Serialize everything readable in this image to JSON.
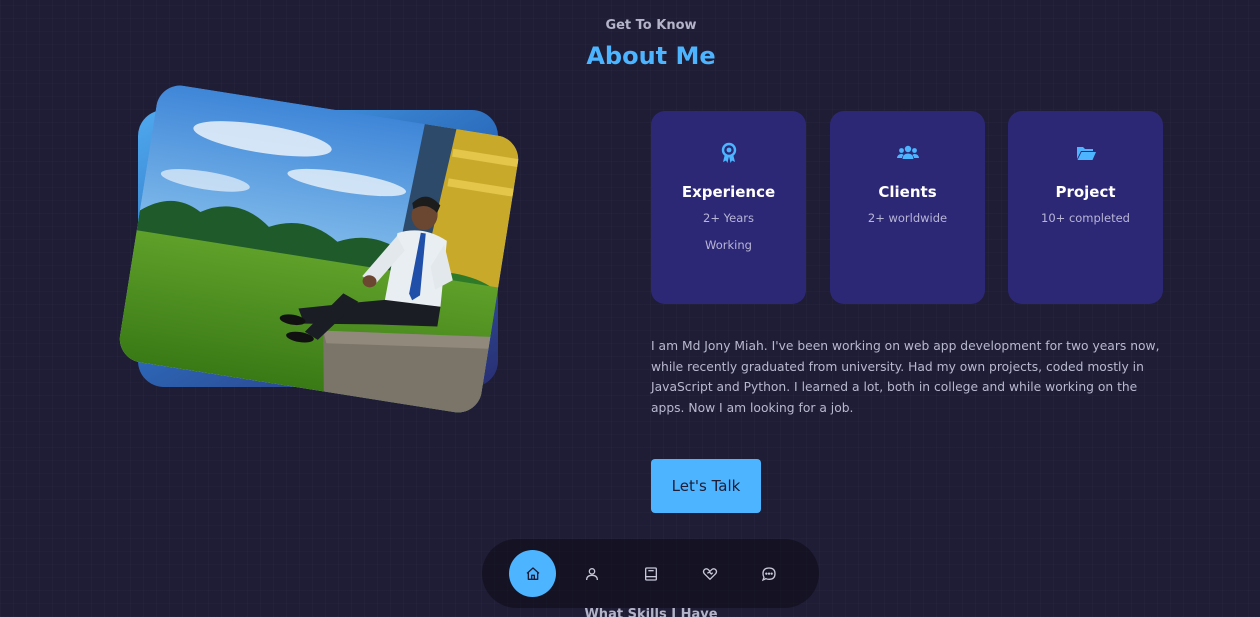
{
  "section": {
    "kicker": "Get To Know",
    "title": "About Me"
  },
  "cards": [
    {
      "icon": "award-icon",
      "title": "Experience",
      "subtitle": "2+ Years Working"
    },
    {
      "icon": "users-icon",
      "title": "Clients",
      "subtitle": "2+ worldwide"
    },
    {
      "icon": "folder-icon",
      "title": "Project",
      "subtitle": "10+ completed"
    }
  ],
  "about": {
    "paragraph": "I am Md Jony Miah. I've been working on web app development for two years now, while recently graduated from university. Had my own projects, coded mostly in JavaScript and Python. I learned a lot, both in college and while working on the apps. Now I am looking for a job.",
    "cta_label": "Let's Talk"
  },
  "nav": {
    "items": [
      {
        "icon": "home-icon",
        "active": true
      },
      {
        "icon": "user-icon",
        "active": false
      },
      {
        "icon": "book-icon",
        "active": false
      },
      {
        "icon": "handshake-icon",
        "active": false
      },
      {
        "icon": "message-icon",
        "active": false
      }
    ]
  },
  "next_section": {
    "kicker": "What Skills I Have"
  },
  "colors": {
    "background": "#1f1d36",
    "accent": "#4db5ff",
    "card": "#2c2876"
  }
}
